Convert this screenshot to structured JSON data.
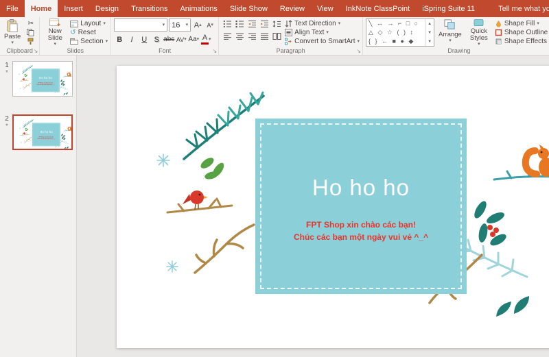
{
  "colors": {
    "ribbon_red": "#C14A2E",
    "teal_box": "#8BCFD8",
    "slide_red_text": "#E8352B",
    "selected_border": "#C4432B"
  },
  "ribbon": {
    "tabs": [
      {
        "label": "File"
      },
      {
        "label": "Home"
      },
      {
        "label": "Insert"
      },
      {
        "label": "Design"
      },
      {
        "label": "Transitions"
      },
      {
        "label": "Animations"
      },
      {
        "label": "Slide Show"
      },
      {
        "label": "Review"
      },
      {
        "label": "View"
      },
      {
        "label": "InkNote ClassPoint"
      },
      {
        "label": "iSpring Suite 11"
      }
    ],
    "tell_me": "Tell me what you want to do",
    "clipboard": {
      "label": "Clipboard",
      "paste": "Paste"
    },
    "slides": {
      "label": "Slides",
      "new_slide": "New Slide",
      "layout": "Layout",
      "reset": "Reset",
      "section": "Section"
    },
    "font": {
      "label": "Font",
      "name": "",
      "size": "16",
      "bold": "B",
      "italic": "I",
      "underline": "U",
      "shadow": "S",
      "strikethrough": "abc",
      "spacing": "AV",
      "case": "Aa",
      "color": "A",
      "grow": "A",
      "shrink": "A"
    },
    "paragraph": {
      "label": "Paragraph",
      "text_direction": "Text Direction",
      "align_text": "Align Text",
      "smartart": "Convert to SmartArt"
    },
    "drawing": {
      "label": "Drawing",
      "arrange": "Arrange",
      "quick_styles": "Quick Styles",
      "shapes_row1": "╲ ↔ → ⌐ □ ○",
      "shapes_row2": "△ ◇ ☆ ( ) ↕",
      "shapes_row3": "{ } ← ■ ● ◆",
      "shape_fill": "Shape Fill",
      "shape_outline": "Shape Outline",
      "shape_effects": "Shape Effects"
    }
  },
  "slides_panel": [
    {
      "number": "1",
      "indicator": "*"
    },
    {
      "number": "2",
      "indicator": "*"
    }
  ],
  "slide": {
    "title": "Ho ho ho",
    "line1": "FPT Shop xin chào các bạn!",
    "line2": "Chúc các bạn một ngày vui vẻ ^_^"
  }
}
